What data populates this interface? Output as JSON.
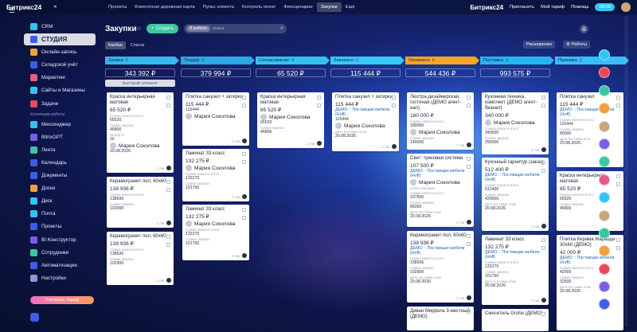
{
  "app": {
    "brand": "Битрикс24",
    "brand_suffix": "✕",
    "brand_right": "Битрикс24"
  },
  "topnav": [
    "Проекты",
    "Клиентская дорожная карта",
    "Пульс клиента",
    "Контроль оплат",
    "Финсценарии",
    "Закупки",
    "Ещё"
  ],
  "topnav_active": 5,
  "topright": {
    "invite": "Пригласить",
    "tariff": "Мой тариф",
    "help": "Помощь",
    "time": "08:29"
  },
  "sidebar": {
    "items": [
      {
        "label": "CRM",
        "color": "#2fc6f6"
      },
      {
        "label": "СТУДИЯ",
        "color": "#3d5de8",
        "active": true
      },
      {
        "label": "Онлайн-запись",
        "color": "#f0a040"
      },
      {
        "label": "Складской учёт",
        "color": "#3d5de8"
      },
      {
        "label": "Маркетинг",
        "color": "#e85a8a"
      },
      {
        "label": "Сайты и Магазины",
        "color": "#2fc6f6"
      },
      {
        "label": "Задачи",
        "color": "#e8495a"
      }
    ],
    "section": "Коллекции работы",
    "items2": [
      {
        "label": "Мессенджер",
        "color": "#2fc6f6"
      },
      {
        "label": "BitrixGPT",
        "color": "#7a5de8"
      },
      {
        "label": "Лента",
        "color": "#3bc8a0"
      },
      {
        "label": "Календарь",
        "color": "#3d5de8"
      },
      {
        "label": "Документы",
        "color": "#3d5de8"
      },
      {
        "label": "Доски",
        "color": "#f0a040"
      },
      {
        "label": "Диск",
        "color": "#2fc6f6"
      },
      {
        "label": "Почта",
        "color": "#2fc6f6"
      },
      {
        "label": "Проекты",
        "color": "#3d5de8"
      },
      {
        "label": "BI Конструктор",
        "color": "#7a5de8"
      },
      {
        "label": "Сотрудники",
        "color": "#3bc8a0"
      },
      {
        "label": "Автоматизации",
        "color": "#3d5de8"
      },
      {
        "label": "Настройки",
        "color": "#8b97d6"
      }
    ],
    "upgrade": "Улучшить тариф"
  },
  "header": {
    "title": "Закупки",
    "create": "Создать",
    "filter_tag": "В работе",
    "search_placeholder": "поиск",
    "view_tabs": [
      "Канбан",
      "Список"
    ],
    "extensions": "Расширения",
    "robots": "Роботы"
  },
  "columns": [
    {
      "name": "Заявка",
      "count": "5",
      "color": "#38b6ef",
      "sum": "343 392 ₽",
      "quick": "Быстрый элемент"
    },
    {
      "name": "Тендер",
      "count": "3",
      "color": "#2fa6e6",
      "sum": "379 994 ₽"
    },
    {
      "name": "Согласование",
      "count": "4",
      "color": "#34c1f0",
      "sum": "65 520 ₽"
    },
    {
      "name": "Заказано",
      "count": "2",
      "color": "#3ac7f7",
      "sum": "115 444 ₽"
    },
    {
      "name": "Оплачено",
      "count": "6",
      "color": "#f5a623",
      "sum": "544 436 ₽"
    },
    {
      "name": "Поставка",
      "count": "4",
      "color": "#27b5f0",
      "sum": "993 575 ₽"
    },
    {
      "name": "Приемка",
      "count": "3",
      "color": "#38bdf8",
      "sum": ""
    }
  ],
  "labels": {
    "client_sum": "Сумма клиента итого",
    "purchase_sum": "Сумма закупки",
    "delivery_date": "Дата поставки план",
    "vat": "Выбор %",
    "responsible": "Ответственный",
    "supplier": "ДЕМО :: Поставщик мебели (Hoff)"
  },
  "cards": {
    "c1": {
      "title": "Краска интерьерная матовая",
      "price": "65 520 ₽",
      "client": "65520",
      "purchase": "46800",
      "vat": "16",
      "user": "Мария Соколова",
      "date": "10.08.2026",
      "ago": "2 Авг"
    },
    "c2": {
      "title": "Керамогранит пол, 60x60",
      "price": "138 936 ₽",
      "client": "138936",
      "purchase": "102900",
      "ago": "2 Авг"
    },
    "c3": {
      "title": "Керамогранит пол, 60x60",
      "price": "138 936 ₽",
      "client": "138936",
      "purchase": "102900",
      "ago": "2 Авг"
    },
    "d1": {
      "title": "Плитка санузел + затирка",
      "price": "115 444 ₽",
      "client": "115444",
      "user": "Мария Соколова",
      "ago": "2 Авг"
    },
    "d2": {
      "title": "Ламинат 33 класс",
      "price": "132 275 ₽",
      "user": "Мария Соколова",
      "client": "132275",
      "purchase": "101750",
      "ago": "2 Авг"
    },
    "d3": {
      "title": "Ламинат 33 класс",
      "price": "132 275 ₽",
      "user": "Мария Соколова",
      "client": "132275",
      "purchase": "101750",
      "ago": "2 Авг"
    },
    "e1": {
      "title": "Краска интерьерная матовая",
      "price": "65 520 ₽",
      "user": "Мария Соколова",
      "client": "65520",
      "purchase": "46800",
      "ago": "2 Авг"
    },
    "f1": {
      "title": "Плитка санузел + затирка",
      "price": "115 444 ₽",
      "client": "115444",
      "user": "Мария Соколова",
      "date": "20.08.2026",
      "ago": "2 Авг"
    },
    "g1": {
      "title": "Люстра дизайнерская, гостиная (ДЕМО агент-нал)",
      "price": "180 000 ₽",
      "client": "180000",
      "user": "Мария Соколова",
      "purchase": "140000",
      "ago": "7 Авг"
    },
    "g2": {
      "title": "Свет: трековая система",
      "price": "107 500 ₽",
      "user": "Мария Соколова",
      "client": "107500",
      "purchase": "86000",
      "date": "20.08.2026",
      "ago": "2 Авг"
    },
    "g3": {
      "title": "Керамогранит пол, 60x60",
      "price": "138 936 ₽",
      "client": "138936",
      "purchase": "102900",
      "date": "20.08.2026",
      "ago": "2 Авг"
    },
    "g4": {
      "title": "Диван Мирроль 3-местный (ДЕМО)"
    },
    "h1": {
      "title": "Кухонная техника, комплект (ДЕМО агент-безнал)",
      "price": "340 000 ₽",
      "user": "Мария Соколова",
      "client": "340000",
      "purchase": "290000",
      "ago": "2 Авг"
    },
    "h2": {
      "title": "Кухонный гарнитур (заказ)",
      "price": "512 400 ₽",
      "client": "512400",
      "purchase": "420000",
      "date": "20.08.2026",
      "ago": "2 Авг"
    },
    "h3": {
      "title": "Ламинат 33 класс",
      "price": "132 275 ₽",
      "client": "132275",
      "purchase": "101750",
      "date": "20.08.2026",
      "ago": "2 Авг"
    },
    "h4": {
      "title": "Смеситель Grohe (ДЕМО)"
    },
    "i1": {
      "title": "Плитка санузел",
      "price": "115 444 ₽",
      "client": "115444",
      "purchase": "80000",
      "date": "20.08.2026"
    },
    "i2": {
      "title": "Краска интерьерная матовая",
      "price": "65 520 ₽",
      "client": "65520",
      "purchase": "46800"
    },
    "i3": {
      "title": "Плитка Керама Марацци 30x60 (ДЕМО)",
      "price": "42 000 ₽",
      "client": "42000",
      "purchase": "32500",
      "date": "20.08.2026"
    }
  }
}
